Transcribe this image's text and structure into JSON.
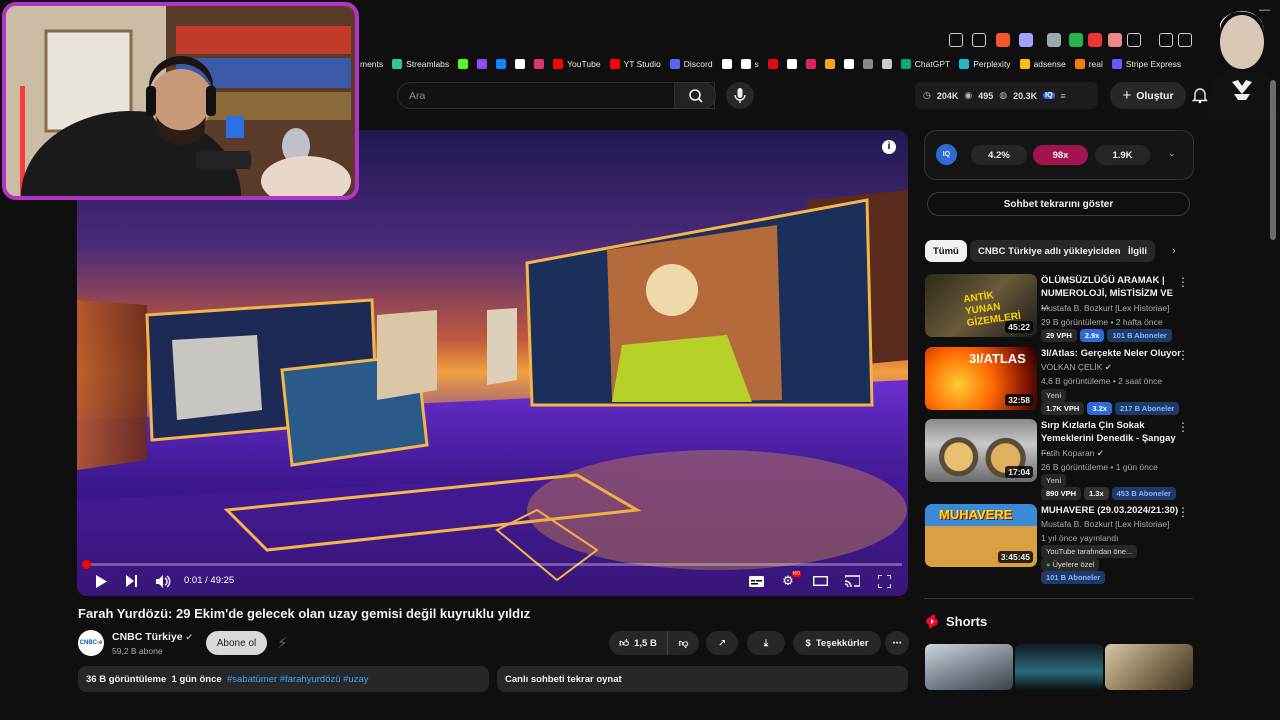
{
  "browser": {
    "bookmarks": [
      {
        "label": "ments",
        "icon": "bookmark-icon",
        "color": "#4b8bf5"
      },
      {
        "label": "Streamlabs",
        "icon": "streamlabs-icon",
        "color": "#31c3a2"
      },
      {
        "label": "",
        "icon": "kick-icon",
        "color": "#53fc18"
      },
      {
        "label": "",
        "icon": "twitch-icon",
        "color": "#9146ff"
      },
      {
        "label": "",
        "icon": "bluesky-icon",
        "color": "#1185fe"
      },
      {
        "label": "",
        "icon": "x-icon",
        "color": "#ffffff"
      },
      {
        "label": "",
        "icon": "instagram-icon",
        "color": "#e1306c"
      },
      {
        "label": "YouTube",
        "icon": "youtube-icon",
        "color": "#ff0000"
      },
      {
        "label": "YT Studio",
        "icon": "yt-studio-icon",
        "color": "#ff0000"
      },
      {
        "label": "Discord",
        "icon": "discord-icon",
        "color": "#5865f2"
      },
      {
        "label": "",
        "icon": "tiktok-icon",
        "color": "#ffffff"
      },
      {
        "label": "s",
        "icon": "tiktok-s-icon",
        "color": "#ffffff"
      },
      {
        "label": "",
        "icon": "netflix-icon",
        "color": "#e50914"
      },
      {
        "label": "",
        "icon": "bookmark-icon",
        "color": "#ffffff"
      },
      {
        "label": "",
        "icon": "bookmark-icon",
        "color": "#e0245e"
      },
      {
        "label": "",
        "icon": "bookmark-icon",
        "color": "#f4a21a"
      },
      {
        "label": "",
        "icon": "amazon-icon",
        "color": "#ffffff"
      },
      {
        "label": "",
        "icon": "bookmark-icon",
        "color": "#888888"
      },
      {
        "label": "",
        "icon": "bookmark-icon",
        "color": "#cccccc"
      },
      {
        "label": "ChatGPT",
        "icon": "chatgpt-icon",
        "color": "#10a37f"
      },
      {
        "label": "Perplexity",
        "icon": "perplexity-icon",
        "color": "#20b8cd"
      },
      {
        "label": "adsense",
        "icon": "adsense-icon",
        "color": "#fbbc04"
      },
      {
        "label": "real",
        "icon": "fox-icon",
        "color": "#f57c00"
      },
      {
        "label": "Stripe Express",
        "icon": "stripe-icon",
        "color": "#635bff"
      }
    ]
  },
  "header": {
    "search_placeholder": "Ara",
    "stats": {
      "views": "204K",
      "watching": "495",
      "subs": "20.3K"
    },
    "create_label": "Oluştur"
  },
  "player": {
    "time": "0:01 / 49:25",
    "progress": 0.0003
  },
  "video": {
    "title": "Farah Yurdözü: 29 Ekim'de gelecek olan uzay gemisi değil kuyruklu yıldız",
    "channel": "CNBC Türkiye",
    "channel_logo_text": "CNBC-e",
    "subs": "59,2 B abone",
    "subscribe_label": "Abone ol",
    "likes": "1,5 B",
    "thanks_label": "Teşekkürler",
    "views": "36 B görüntüleme",
    "age": "1 gün önce",
    "hashtags": "#sabatümer #farahyurdözü #uzay",
    "chat_replay": "Canlı sohbeti tekrar oynat"
  },
  "sidebar": {
    "iq": {
      "badge": "IQ",
      "v1": "4.2%",
      "v2": "98x",
      "v3": "1.9K"
    },
    "chat_button": "Sohbet tekrarını göster",
    "chips": [
      "Tümü",
      "CNBC Türkiye adlı yükleyiciden",
      "İlgili"
    ],
    "recs": [
      {
        "title": "ÖLÜMSÜZLÜĞÜ ARAMAK | NUMEROLOJİ, MİSTİSİZM VE ...",
        "channel": "Mustafa B. Bozkurt [Lex Historiae]",
        "meta": "29 B görüntüleme • 2 hafta önce",
        "duration": "45:22",
        "thumb_text": "ANTİK YUNAN GİZEMLERİ",
        "tags": [
          {
            "t": "29 VPH",
            "bg": "#2a2a2a",
            "c": "#ffffff"
          },
          {
            "t": "2.9x",
            "bg": "#2f6bd8",
            "c": "#ffffff"
          },
          {
            "t": "101 B Aboneler",
            "bg": "#1e3a66",
            "c": "#8fb3ff"
          }
        ]
      },
      {
        "title": "3I/Atlas: Gerçekte Neler Oluyor",
        "channel": "VOLKAN ÇELİK",
        "meta": "4,6 B görüntüleme • 2 saat önce",
        "duration": "32:58",
        "thumb_text": "3I/ATLAS",
        "badge": "Yeni",
        "tags": [
          {
            "t": "1.7K VPH",
            "bg": "#2a2a2a",
            "c": "#ffffff"
          },
          {
            "t": "3.2x",
            "bg": "#2f6bd8",
            "c": "#ffffff"
          },
          {
            "t": "217 B Aboneler",
            "bg": "#1e3a66",
            "c": "#8fb3ff"
          }
        ]
      },
      {
        "title": "Sırp Kızlarla Çin Sokak Yemeklerini Denedik - Şangay ...",
        "channel": "Fatih Koparan",
        "meta": "26 B görüntüleme • 1 gün önce",
        "duration": "17:04",
        "thumb_text": "",
        "badge": "Yeni",
        "tags": [
          {
            "t": "890 VPH",
            "bg": "#2a2a2a",
            "c": "#ffffff"
          },
          {
            "t": "1.3x",
            "bg": "#333333",
            "c": "#ffffff"
          },
          {
            "t": "453 B Aboneler",
            "bg": "#1e3a66",
            "c": "#8fb3ff"
          }
        ]
      },
      {
        "title": "MUHAVERE (29.03.2024/21:30)",
        "channel": "Mustafa B. Bozkurt [Lex Historiae]",
        "meta": "1 yıl önce yayınlandı",
        "duration": "3:45:45",
        "thumb_text": "MUHAVERE",
        "badge": "YouTube tarafından öne...",
        "members": "Üyelere özel",
        "tags": [
          {
            "t": "101 B Aboneler",
            "bg": "#1e3a66",
            "c": "#8fb3ff"
          }
        ]
      }
    ],
    "shorts_label": "Shorts"
  },
  "colors": {
    "accent": "#ff0000",
    "webcam_border": "#b133c8",
    "iq_pink": "#a3134f"
  }
}
